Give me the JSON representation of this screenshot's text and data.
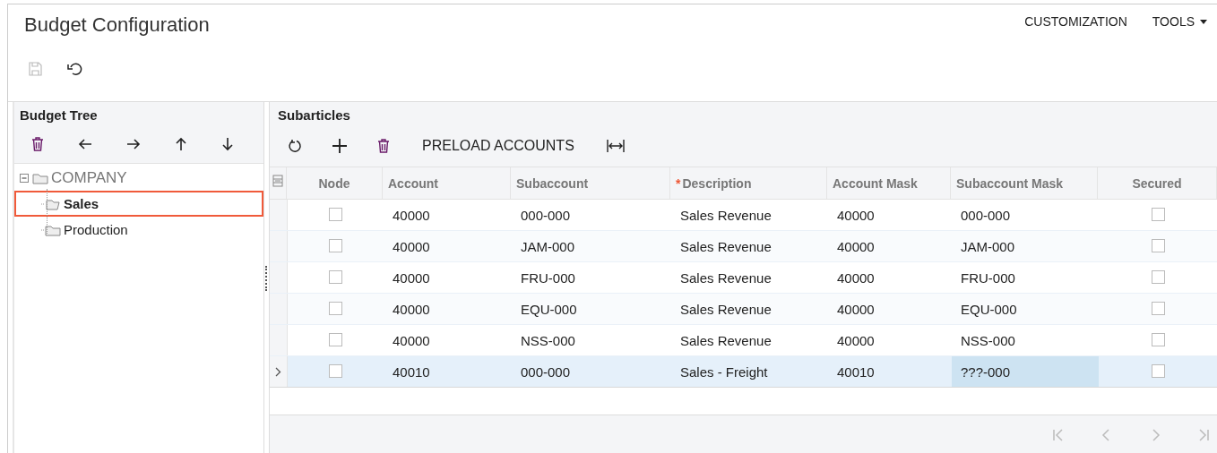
{
  "page": {
    "title": "Budget Configuration",
    "menu": [
      {
        "label": "CUSTOMIZATION",
        "dropdown": false
      },
      {
        "label": "TOOLS",
        "dropdown": true
      }
    ],
    "save_button": {
      "disabled": true
    }
  },
  "tree_panel": {
    "title": "Budget Tree",
    "nodes": [
      {
        "label": "COMPANY",
        "expanded": true,
        "selected": false,
        "children": [
          {
            "label": "Sales",
            "selected": true
          },
          {
            "label": "Production",
            "selected": false
          }
        ]
      }
    ]
  },
  "grid": {
    "title": "Subarticles",
    "preload_button": "PRELOAD ACCOUNTS",
    "columns": [
      {
        "label": "Node",
        "kind": "check"
      },
      {
        "label": "Account",
        "kind": "text"
      },
      {
        "label": "Subaccount",
        "kind": "text"
      },
      {
        "label": "Description",
        "kind": "text",
        "required_mark": "*"
      },
      {
        "label": "Account Mask",
        "kind": "text"
      },
      {
        "label": "Subaccount Mask",
        "kind": "text"
      },
      {
        "label": "Secured",
        "kind": "check"
      }
    ],
    "rows": [
      {
        "selected": false,
        "node": false,
        "account": "40000",
        "subaccount": "000-000",
        "description": "Sales Revenue",
        "account_mask": "40000",
        "subaccount_mask": {
          "text": "000-000",
          "focused": false
        },
        "secured": false
      },
      {
        "selected": false,
        "node": false,
        "account": "40000",
        "subaccount": "JAM-000",
        "description": "Sales Revenue",
        "account_mask": "40000",
        "subaccount_mask": {
          "text": "JAM-000",
          "focused": false
        },
        "secured": false
      },
      {
        "selected": false,
        "node": false,
        "account": "40000",
        "subaccount": "FRU-000",
        "description": "Sales Revenue",
        "account_mask": "40000",
        "subaccount_mask": {
          "text": "FRU-000",
          "focused": false
        },
        "secured": false
      },
      {
        "selected": false,
        "node": false,
        "account": "40000",
        "subaccount": "EQU-000",
        "description": "Sales Revenue",
        "account_mask": "40000",
        "subaccount_mask": {
          "text": "EQU-000",
          "focused": false
        },
        "secured": false
      },
      {
        "selected": false,
        "node": false,
        "account": "40000",
        "subaccount": "NSS-000",
        "description": "Sales Revenue",
        "account_mask": "40000",
        "subaccount_mask": {
          "text": "NSS-000",
          "focused": false
        },
        "secured": false
      },
      {
        "selected": true,
        "node": false,
        "account": "40010",
        "subaccount": "000-000",
        "description": "Sales - Freight",
        "account_mask": "40010",
        "subaccount_mask": {
          "text": "???-000",
          "focused": true
        },
        "secured": false
      }
    ]
  }
}
